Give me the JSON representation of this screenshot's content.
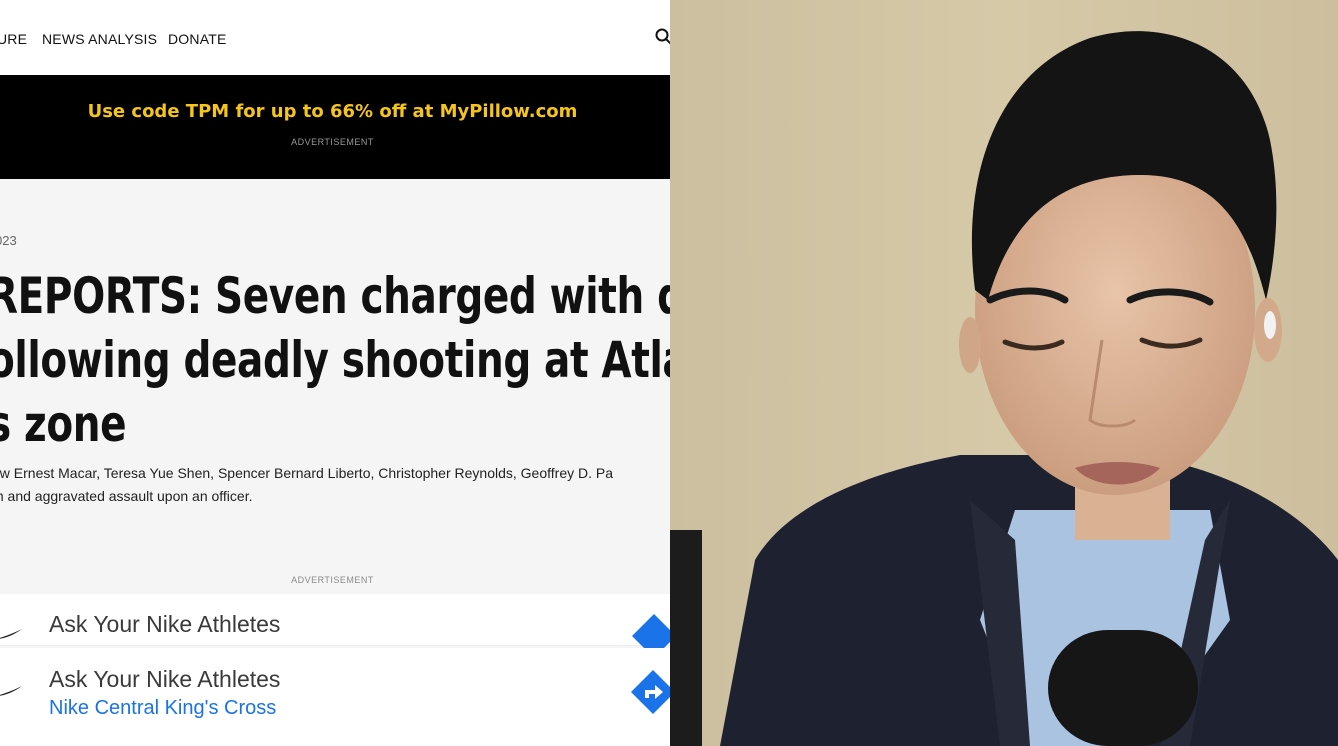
{
  "nav": {
    "items": [
      "URE",
      "NEWS ANALYSIS",
      "DONATE"
    ]
  },
  "banner": {
    "promo_text": "Use code TPM for up to 66% off at MyPillow.com",
    "ad_label": "ADVERTISEMENT"
  },
  "article": {
    "date_fragment": "023",
    "headline_lines": [
      "REPORTS: Seven charged with dom",
      "ollowing deadly shooting at Atlant",
      "s zone"
    ],
    "summary_lines": [
      "ew Ernest Macar, Teresa Yue Shen, Spencer Bernard Liberto, Christopher Reynolds, Geoffrey D. Pa",
      "m and aggravated assault upon an officer."
    ]
  },
  "ad": {
    "label": "ADVERTISEMENT",
    "row1_title": "Ask Your Nike Athletes",
    "row2_title": "Ask Your Nike Athletes",
    "row2_subtitle": "Nike Central King's Cross",
    "accent_color": "#1a73e8"
  },
  "colors": {
    "banner_text": "#f5c518",
    "banner_bg": "#000000"
  }
}
